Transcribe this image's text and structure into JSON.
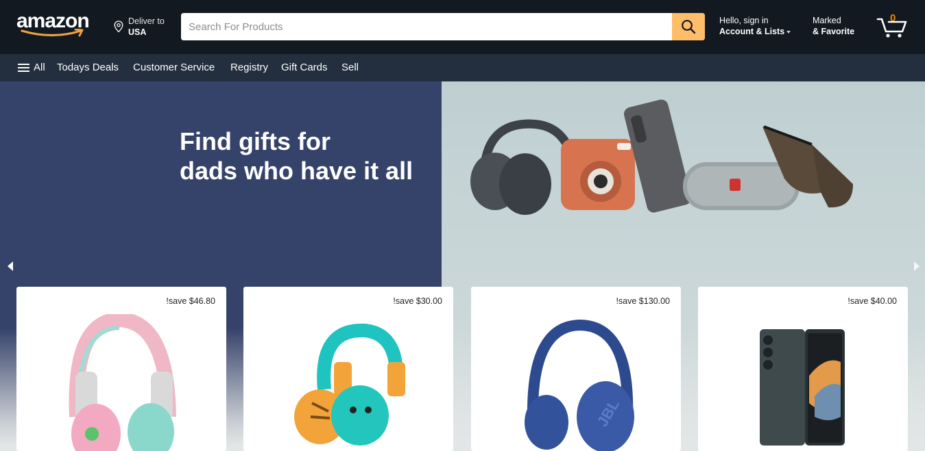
{
  "header": {
    "logo_text": "amazon",
    "deliver_label": "Deliver to",
    "deliver_location": "USA",
    "search_placeholder": "Search For Products",
    "account_greeting": "Hello, sign in",
    "account_label": "Account & Lists",
    "marked_line1": "Marked",
    "marked_line2": "& Favorite",
    "cart_count": "0",
    "accent_color": "#febd69",
    "cart_count_color": "#f08804"
  },
  "nav": {
    "all_label": "All",
    "items": [
      "Todays Deals",
      "Customer Service",
      "Registry",
      "Gift Cards",
      "Sell"
    ]
  },
  "hero": {
    "title_line1": "Find gifts for",
    "title_line2": "dads who have it all",
    "prev_icon": "triangle-left-icon",
    "next_icon": "triangle-right-icon"
  },
  "products": [
    {
      "save": "!save $46.80",
      "image": "kids-headphones-pink"
    },
    {
      "save": "!save $30.00",
      "image": "kids-headphones-tiger"
    },
    {
      "save": "!save $130.00",
      "image": "jbl-headphones-blue"
    },
    {
      "save": "!save $40.00",
      "image": "foldable-phone"
    }
  ]
}
